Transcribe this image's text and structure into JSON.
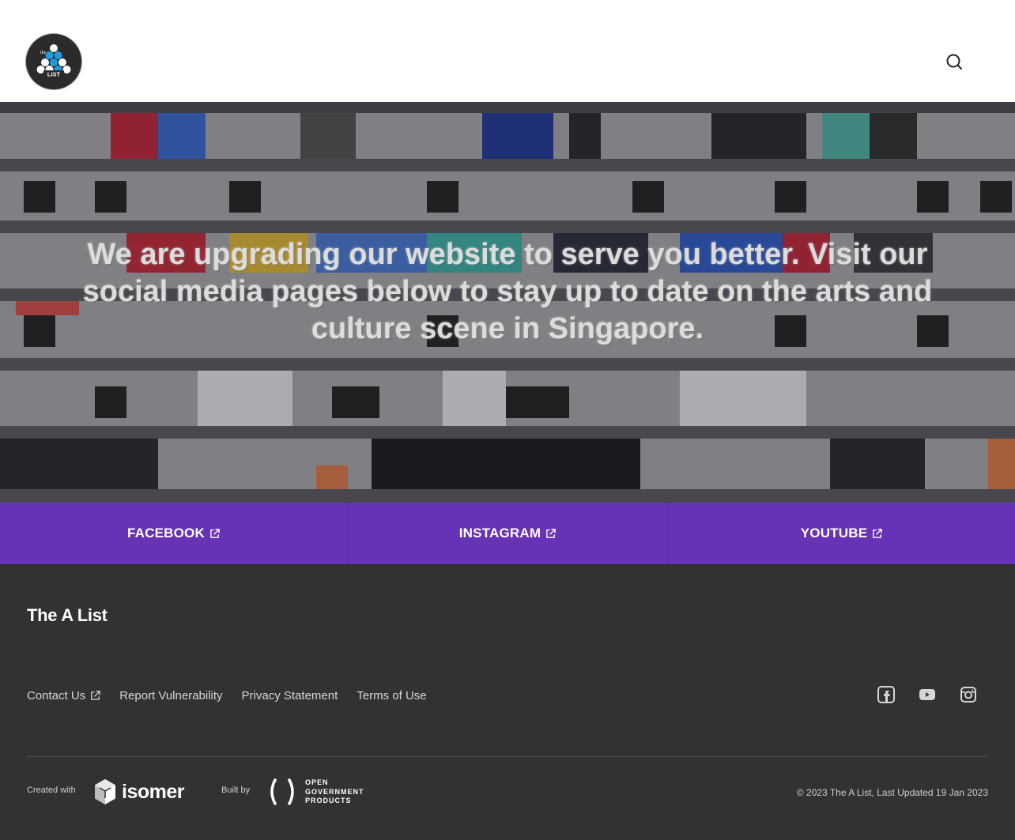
{
  "header": {
    "logo_alt": "the A LIST",
    "logo_small_text": "the",
    "logo_big_text": "LIST",
    "search_icon": "search-icon"
  },
  "hero": {
    "message": "We are upgrading our website to serve you better. Visit our social media pages below to stay up to date on the arts and culture scene in Singapore."
  },
  "social_bar": {
    "items": [
      {
        "label": "FACEBOOK",
        "icon": "external-link-icon"
      },
      {
        "label": "INSTAGRAM",
        "icon": "external-link-icon"
      },
      {
        "label": "YOUTUBE",
        "icon": "external-link-icon"
      }
    ]
  },
  "footer": {
    "title": "The A List",
    "links": [
      {
        "label": "Contact Us",
        "icon": "external-link-icon"
      },
      {
        "label": "Report Vulnerability"
      },
      {
        "label": "Privacy Statement"
      },
      {
        "label": "Terms of Use"
      }
    ],
    "social_icons": [
      "facebook-icon",
      "youtube-icon",
      "instagram-icon"
    ],
    "created_with": "Created with",
    "isomer_label": "isomer",
    "built_by": "Built by",
    "ogp_label": "OPEN\nGOVERNMENT\nPRODUCTS",
    "copyright": "© 2023 The A List, Last Updated 19 Jan 2023"
  },
  "colors": {
    "accent": "#6632b6",
    "footer_bg": "#323232",
    "logo_blue": "#1e9be0"
  }
}
